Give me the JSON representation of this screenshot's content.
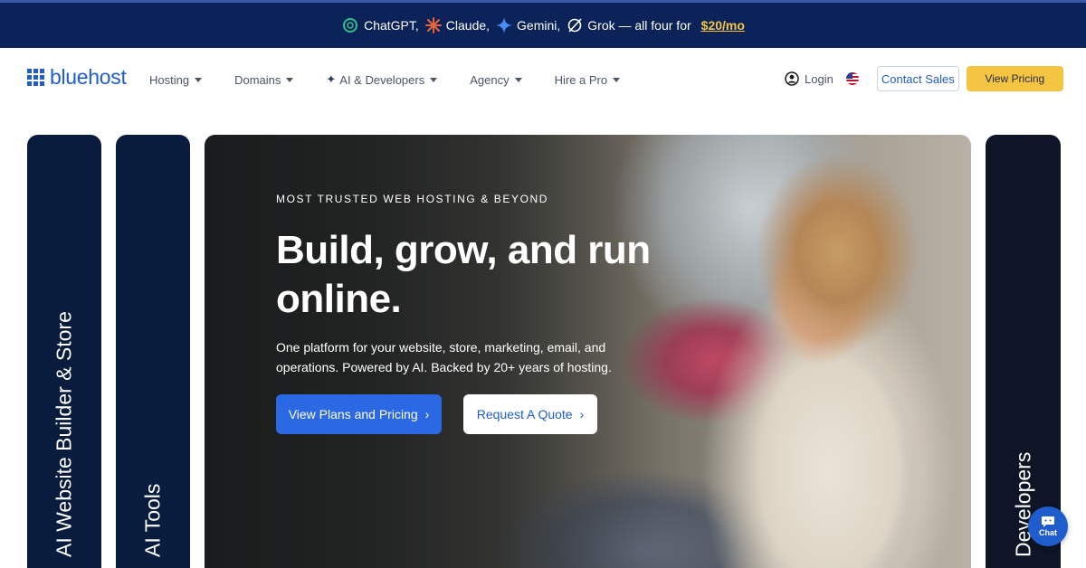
{
  "promo": {
    "items": [
      {
        "label": "ChatGPT,",
        "icon": "chatgpt-icon"
      },
      {
        "label": "Claude,",
        "icon": "claude-icon"
      },
      {
        "label": "Gemini,",
        "icon": "gemini-icon"
      },
      {
        "label": "Grok — all four for",
        "icon": "grok-icon"
      }
    ],
    "price": "$20/mo"
  },
  "brand": {
    "name": "bluehost"
  },
  "nav": {
    "items": [
      {
        "label": "Hosting"
      },
      {
        "label": "Domains"
      },
      {
        "label": "AI & Developers"
      },
      {
        "label": "Agency"
      },
      {
        "label": "Hire a Pro"
      }
    ],
    "login": "Login",
    "contact": "Contact Sales",
    "pricing": "View Pricing"
  },
  "side_cards": {
    "left1": "AI Website Builder & Store",
    "left2": "AI Tools",
    "right": "Developers"
  },
  "hero": {
    "eyebrow": "MOST TRUSTED WEB HOSTING & BEYOND",
    "headline": "Build, grow, and run online.",
    "subtext": "One platform for your website, store, marketing, email, and operations. Powered by AI. Backed by 20+ years of hosting.",
    "primary_cta": "View Plans and Pricing",
    "secondary_cta": "Request A Quote"
  },
  "chat": {
    "label": "Chat"
  },
  "colors": {
    "brand_blue": "#1f5dcd",
    "promo_bg": "#0b2358",
    "accent_yellow": "#f5c542",
    "card_navy": "#0a1c3e"
  }
}
